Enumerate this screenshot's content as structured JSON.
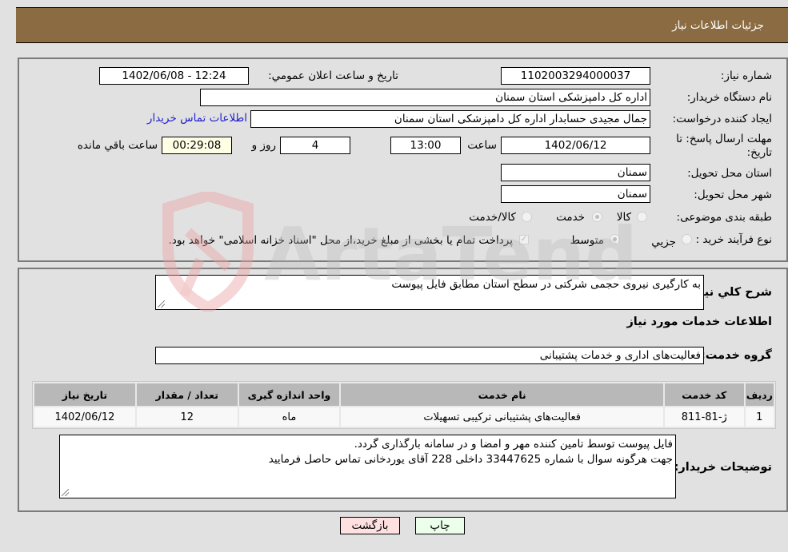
{
  "header": {
    "title": "جزئیات اطلاعات نیاز"
  },
  "form": {
    "need_number": {
      "label": "شماره نیاز:",
      "value": "1102003294000037"
    },
    "announce_datetime": {
      "label": "تاریخ و ساعت اعلان عمومي:",
      "value": "1402/06/08 - 12:24"
    },
    "buyer_org": {
      "label": "نام دستگاه خریدار:",
      "value": "اداره کل دامپزشکی استان سمنان"
    },
    "requester": {
      "label": "ایجاد کننده درخواست:",
      "value": "جمال مجیدی حسابدار اداره کل دامپزشکی استان سمنان",
      "contact_link": "اطلاعات تماس خریدار"
    },
    "deadline": {
      "label": "مهلت ارسال پاسخ: تا تاریخ:",
      "date": "1402/06/12",
      "time_label": "ساعت",
      "time": "13:00",
      "days": "4",
      "days_label": "روز و",
      "remaining": "00:29:08",
      "remaining_label": "ساعت باقي مانده"
    },
    "delivery_province": {
      "label": "استان محل تحویل:",
      "value": "سمنان"
    },
    "delivery_city": {
      "label": "شهر محل تحویل:",
      "value": "سمنان"
    },
    "category": {
      "label": "طبقه بندی موضوعی:",
      "options": [
        {
          "label": "کالا",
          "checked": false
        },
        {
          "label": "خدمت",
          "checked": true
        },
        {
          "label": "کالا/خدمت",
          "checked": false
        }
      ]
    },
    "purchase_process": {
      "label": "نوع فرآیند خرید :",
      "options": [
        {
          "label": "جزيي",
          "checked": false
        },
        {
          "label": "متوسط",
          "checked": true
        }
      ],
      "treasury_checkbox": {
        "checked": true,
        "label": "پرداخت تمام یا بخشی از مبلغ خرید،از محل \"اسناد خزانه اسلامی\" خواهد بود."
      }
    }
  },
  "details": {
    "description_label": "شرح کلي نیاز:",
    "description": "به کارگیری نیروی حجمی شرکتی در سطح استان مطابق فایل پیوست",
    "services_heading": "اطلاعات خدمات مورد نیاز",
    "service_group_label": "گروه خدمت:",
    "service_group": "فعالیت‌های اداری و خدمات پشتیبانی",
    "table": {
      "headers": [
        "ردیف",
        "کد خدمت",
        "نام خدمت",
        "واحد اندازه گیری",
        "تعداد / مقدار",
        "تاریخ نیاز"
      ],
      "rows": [
        [
          "1",
          "ژ-81-811",
          "فعالیت‌های پشتیبانی ترکیبی تسهیلات",
          "ماه",
          "12",
          "1402/06/12"
        ]
      ]
    },
    "buyer_notes_label": "توضیحات خریدار:",
    "buyer_notes_line1": "فایل پیوست توسط تامین کننده مهر و امضا و در سامانه بارگذاری گردد.",
    "buyer_notes_line2": "جهت هرگونه سوال با شماره 33447625 داخلی 228 آقای یوردخانی تماس حاصل فرمایید"
  },
  "buttons": {
    "print": "چاپ",
    "back": "بازگشت"
  },
  "watermark": {
    "text": "ArtaTender.net"
  },
  "colors": {
    "header_bg": "#8b6b41",
    "link": "#2222cc",
    "back_btn": "#ffe0e0",
    "print_btn": "#ebffeb"
  }
}
